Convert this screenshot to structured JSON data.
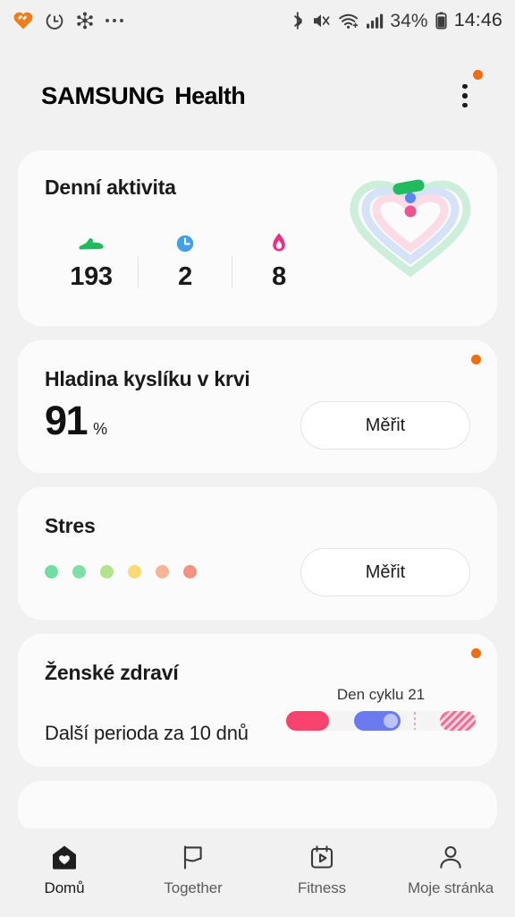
{
  "status_bar": {
    "left_icons": [
      "samsung-health-heart-icon",
      "alarm-icon",
      "smartthings-icon",
      "more-notifications-icon"
    ],
    "right_icons": [
      "bluetooth-icon",
      "mute-icon",
      "wifi-icon",
      "signal-icon",
      "battery-icon"
    ],
    "battery_percent": "34%",
    "time": "14:46"
  },
  "header": {
    "brand_first": "SAMSUNG",
    "brand_second": "Health",
    "overflow_menu": "more-options"
  },
  "colors": {
    "accent_orange": "#ef6c12",
    "steps_green": "#21ba5e",
    "time_blue": "#43a0e5",
    "calories_pink": "#ec2e8a",
    "period_pink": "#f8436e",
    "fertile_blue": "#6b7bef",
    "background": "#f1f1f1",
    "card": "#fbfbfb"
  },
  "cards": {
    "activity": {
      "title": "Denní aktivita",
      "has_badge": false,
      "stats": [
        {
          "icon": "shoe-icon",
          "value": "193",
          "color": "#21ba5e"
        },
        {
          "icon": "clock-icon",
          "value": "2",
          "color": "#43a0e5"
        },
        {
          "icon": "flame-icon",
          "value": "8",
          "color": "#ec2e8a"
        }
      ],
      "rings": {
        "outer_color": "#21ba5e",
        "middle_color": "#5b87e8",
        "inner_color": "#f0538f"
      }
    },
    "oxygen": {
      "title": "Hladina kyslíku v krvi",
      "value": "91",
      "unit": "%",
      "button_label": "Měřit",
      "has_badge": true
    },
    "stress": {
      "title": "Stres",
      "button_label": "Měřit",
      "has_badge": false,
      "dots": [
        "#74dda4",
        "#7fe0a7",
        "#b2e48c",
        "#fada74",
        "#f8b496",
        "#f49183"
      ]
    },
    "women": {
      "title": "Ženské zdraví",
      "subtitle": "Další perioda za 10 dnů",
      "cycle_label": "Den cyklu 21",
      "has_badge": true
    }
  },
  "bottom_nav": [
    {
      "label": "Domů",
      "icon": "home-heart-icon",
      "active": true
    },
    {
      "label": "Together",
      "icon": "flag-icon",
      "active": false
    },
    {
      "label": "Fitness",
      "icon": "calendar-play-icon",
      "active": false
    },
    {
      "label": "Moje stránka",
      "icon": "person-icon",
      "active": false
    }
  ]
}
